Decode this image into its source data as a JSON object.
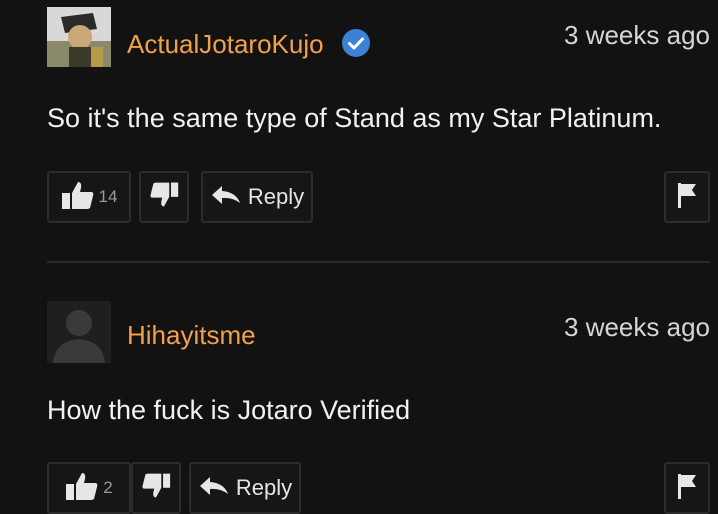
{
  "comments": [
    {
      "username": "ActualJotaroKujo",
      "verified": true,
      "timestamp": "3 weeks ago",
      "text": "So it's the same type of Stand as my Star Platinum.",
      "upvotes": "14",
      "reply_label": "Reply",
      "icons": {
        "avatar": "character-avatar",
        "verified": "verified-badge-icon",
        "up": "thumbs-up-icon",
        "down": "thumbs-down-icon",
        "reply": "reply-arrow-icon",
        "flag": "flag-icon"
      }
    },
    {
      "username": "Hihayitsme",
      "verified": false,
      "timestamp": "3 weeks ago",
      "text": "How the fuck is Jotaro Verified",
      "upvotes": "2",
      "reply_label": "Reply",
      "icons": {
        "avatar": "default-user-avatar",
        "up": "thumbs-up-icon",
        "down": "thumbs-down-icon",
        "reply": "reply-arrow-icon",
        "flag": "flag-icon"
      }
    }
  ],
  "colors": {
    "background": "#121212",
    "username": "#f3a04a",
    "verified_badge": "#3b82d6",
    "text": "#f2f2f2",
    "muted": "#9a9a9a"
  }
}
